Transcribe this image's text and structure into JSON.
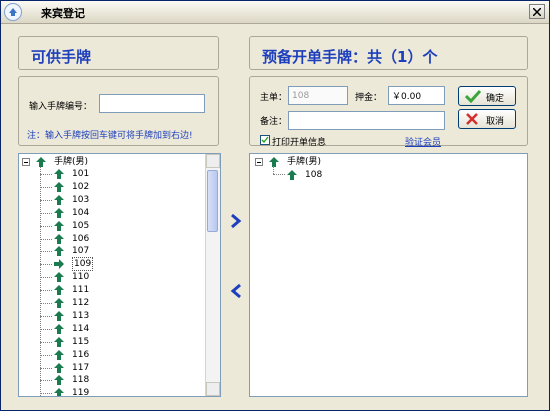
{
  "window": {
    "title": "来宾登记"
  },
  "left_panel": {
    "header": "可供手牌",
    "input_label": "输入手牌编号：",
    "input_value": "",
    "hint": "注：输入手牌按回车键可将手牌加到右边!",
    "tree_root": "手牌(男)",
    "items": [
      "101",
      "102",
      "103",
      "104",
      "105",
      "106",
      "107",
      "109",
      "110",
      "111",
      "112",
      "113",
      "114",
      "115",
      "116",
      "117",
      "118",
      "119"
    ],
    "selected_item": "109"
  },
  "right_panel": {
    "header": "预备开单手牌：共（1）个",
    "main_label": "主单：",
    "main_value": "108",
    "deposit_label": "押金：",
    "deposit_value": "￥0.00",
    "note_label": "备注：",
    "note_value": "",
    "print_checkbox_label": "打印开单信息",
    "print_checked": true,
    "verify_link": "验证会员",
    "ok_label": "确定",
    "cancel_label": "取消",
    "tree_root": "手牌(男)",
    "items": [
      "108"
    ]
  },
  "colors": {
    "accent": "#1d3fbd",
    "icon_green": "#1a7b4e",
    "cancel_red": "#d32f2f"
  },
  "icons": [
    "app-icon",
    "close-icon",
    "expander-icon",
    "arrow-up-icon",
    "arrow-right-icon",
    "chevron-right-icon",
    "chevron-left-icon",
    "check-icon",
    "cross-icon"
  ]
}
